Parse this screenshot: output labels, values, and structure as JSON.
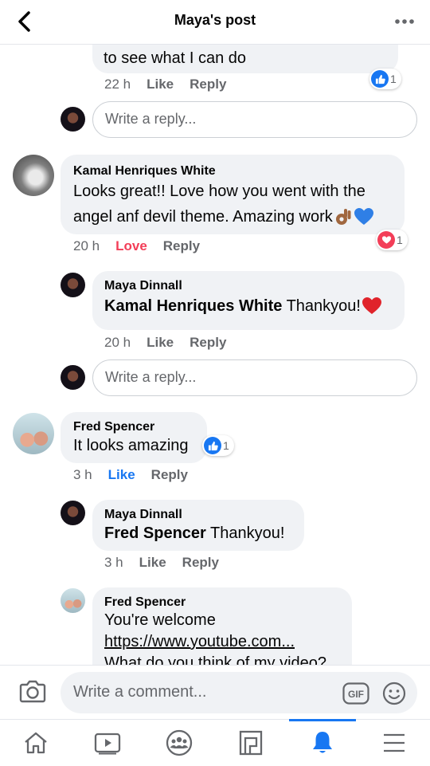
{
  "header": {
    "title": "Maya's post"
  },
  "comments": {
    "top_reply": {
      "text": "to see what I can do",
      "time": "22 h",
      "like": "Like",
      "reply": "Reply",
      "react_count": "1"
    },
    "reply_box_1": {
      "placeholder": "Write a reply..."
    },
    "kamal": {
      "name": "Kamal Henriques White",
      "text_line1": "Looks great!! Love how you went with the",
      "text_line2": "angel anf devil theme. Amazing work",
      "time": "20 h",
      "reaction_label": "Love",
      "reply": "Reply",
      "react_count": "1",
      "reply1": {
        "name": "Maya Dinnall",
        "mention": "Kamal Henriques White",
        "text": " Thankyou!",
        "time": "20 h",
        "like": "Like",
        "reply": "Reply"
      }
    },
    "reply_box_2": {
      "placeholder": "Write a reply..."
    },
    "fred": {
      "name": "Fred Spencer",
      "text": "It looks amazing",
      "react_count": "1",
      "time": "3 h",
      "reaction_label": "Like",
      "reply": "Reply",
      "reply1": {
        "name": "Maya Dinnall",
        "mention": "Fred Spencer",
        "text": " Thankyou!",
        "time": "3 h",
        "like": "Like",
        "reply": "Reply"
      },
      "reply2": {
        "name": "Fred Spencer",
        "line1": "You're welcome",
        "link": "https://www.youtube.com...",
        "line3": "What do you think of my video?"
      }
    }
  },
  "composer": {
    "placeholder": "Write a comment...",
    "gif_label": "GIF"
  },
  "colors": {
    "accent": "#1877f2",
    "love": "#f33e58",
    "bubble": "#f0f2f5",
    "meta": "#65676b"
  },
  "tabs": [
    "home-icon",
    "watch-icon",
    "groups-icon",
    "pages-icon",
    "notifications-icon",
    "menu-icon"
  ]
}
